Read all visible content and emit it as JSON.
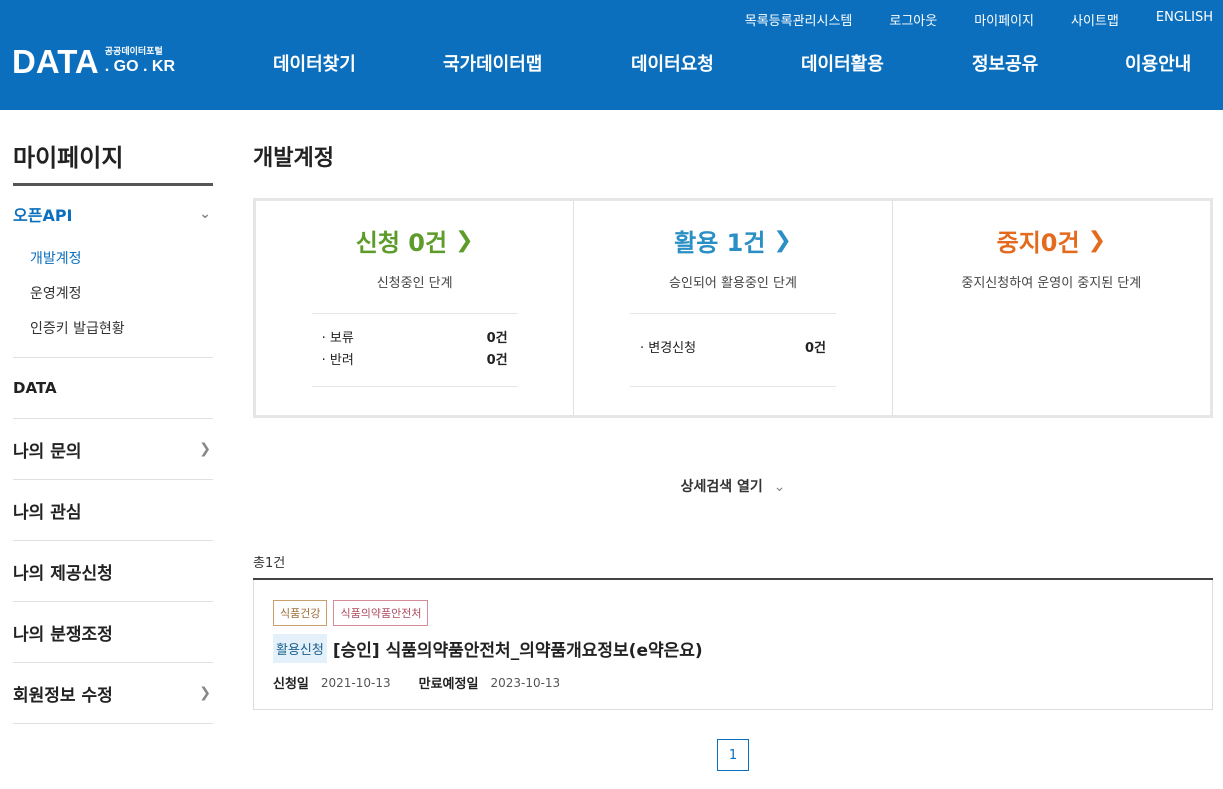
{
  "header": {
    "logo_main": "DATA",
    "logo_sub1": "공공데이터포털",
    "logo_sub2": ". GO . KR",
    "util_links": [
      "목록등록관리시스템",
      "로그아웃",
      "마이페이지",
      "사이트맵",
      "ENGLISH"
    ],
    "gnb": [
      "데이터찾기",
      "국가데이터맵",
      "데이터요청",
      "데이터활용",
      "정보공유",
      "이용안내"
    ]
  },
  "sidebar": {
    "title": "마이페이지",
    "open_section": {
      "label": "오픈API",
      "subitems": [
        "개발계정",
        "운영계정",
        "인증키 발급현황"
      ]
    },
    "data_label": "DATA",
    "items": [
      {
        "label": "나의 문의",
        "has_chevron": true
      },
      {
        "label": "나의 관심",
        "has_chevron": false
      },
      {
        "label": "나의 제공신청",
        "has_chevron": false
      },
      {
        "label": "나의 분쟁조정",
        "has_chevron": false
      },
      {
        "label": "회원정보 수정",
        "has_chevron": true
      }
    ]
  },
  "main": {
    "title": "개발계정",
    "status": {
      "apply": {
        "title": "신청 0건",
        "desc": "신청중인 단계",
        "rows": [
          {
            "label": "· 보류",
            "value": "0건"
          },
          {
            "label": "· 반려",
            "value": "0건"
          }
        ]
      },
      "use": {
        "title": "활용 1건",
        "desc": "승인되어 활용중인 단계",
        "rows": [
          {
            "label": "· 변경신청",
            "value": "0건"
          }
        ]
      },
      "stop": {
        "title": "중지0건",
        "desc": "중지신청하여 운영이 중지된 단계"
      }
    },
    "detail_toggle": "상세검색 열기",
    "total": "총1건",
    "card": {
      "tags": [
        "식품건강",
        "식품의약품안전처"
      ],
      "badge": "활용신청",
      "title": "[승인] 식품의약품안전처_의약품개요정보(e약은요)",
      "apply_date_label": "신청일",
      "apply_date": "2021-10-13",
      "expire_date_label": "만료예정일",
      "expire_date": "2023-10-13"
    },
    "page": "1"
  },
  "colors": {
    "header_bg": "#0b6fbd",
    "apply": "#5d9b2a",
    "use": "#2a8fc4",
    "stop": "#e46a1e"
  }
}
